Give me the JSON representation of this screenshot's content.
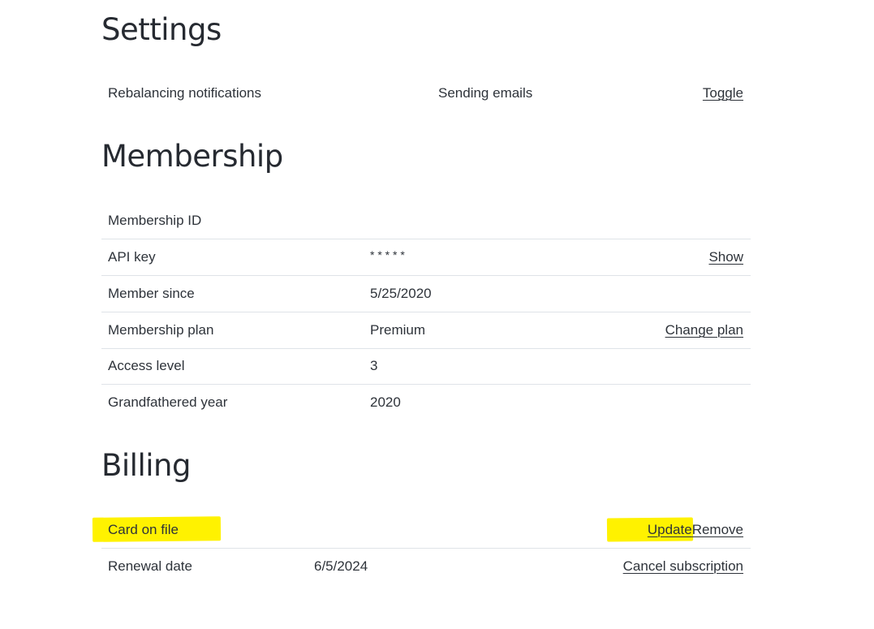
{
  "settings": {
    "title": "Settings",
    "rows": [
      {
        "label": "Rebalancing notifications",
        "value": "Sending emails",
        "action": "Toggle"
      }
    ]
  },
  "membership": {
    "title": "Membership",
    "rows": [
      {
        "label": "Membership ID",
        "value": "",
        "action": ""
      },
      {
        "label": "API key",
        "value": "* * * * *",
        "action": "Show"
      },
      {
        "label": "Member since",
        "value": "5/25/2020",
        "action": ""
      },
      {
        "label": "Membership plan",
        "value": "Premium",
        "action": "Change plan"
      },
      {
        "label": "Access level",
        "value": "3",
        "action": ""
      },
      {
        "label": "Grandfathered year",
        "value": "2020",
        "action": ""
      }
    ]
  },
  "billing": {
    "title": "Billing",
    "card_on_file": {
      "label": "Card on file",
      "update": "Update",
      "remove": "Remove"
    },
    "renewal": {
      "label": "Renewal date",
      "value": "6/5/2024",
      "action": "Cancel subscription"
    }
  },
  "colors": {
    "highlight": "#fff200",
    "divider": "#dfe3e8",
    "text": "#2e333a"
  }
}
